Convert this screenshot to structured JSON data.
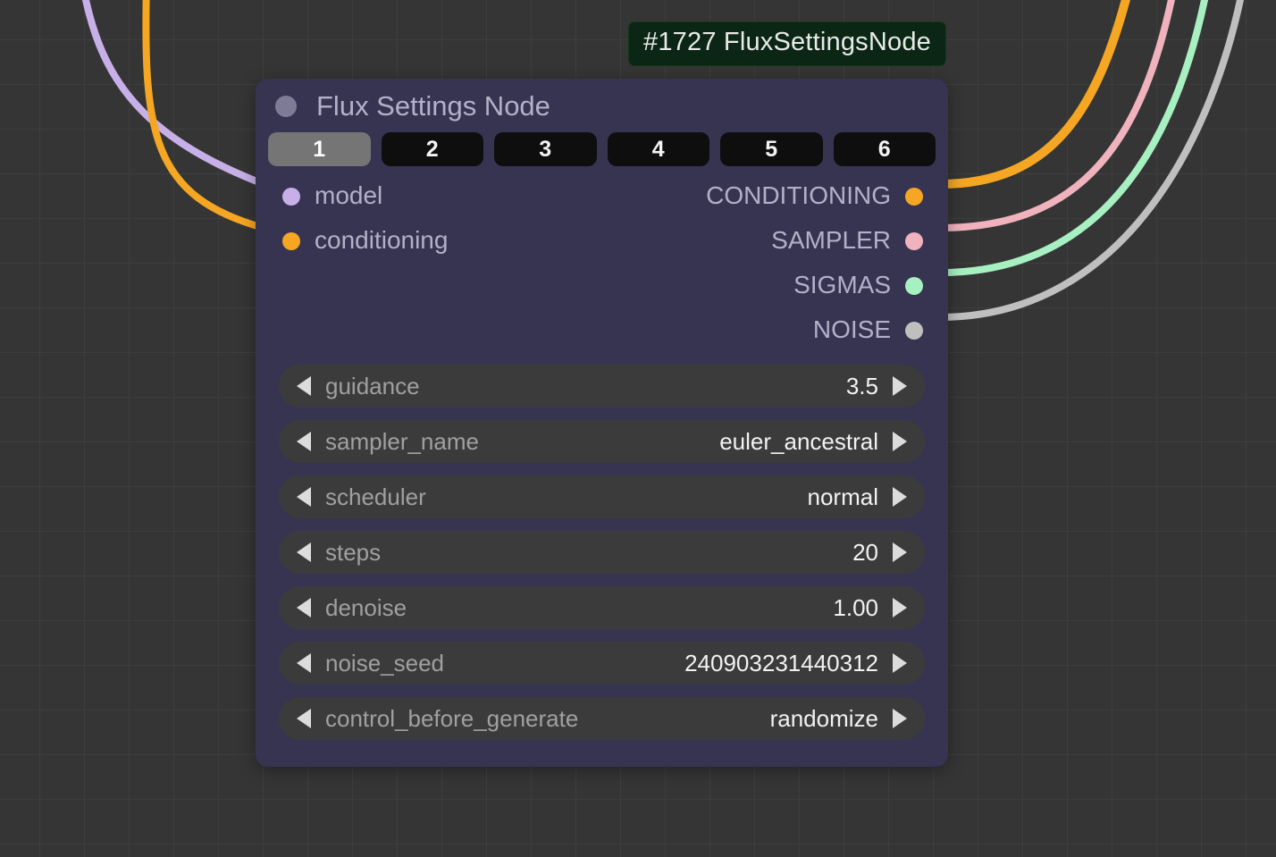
{
  "badge": "#1727 FluxSettingsNode",
  "node": {
    "title": "Flux Settings Node",
    "tabs": [
      "1",
      "2",
      "3",
      "4",
      "5",
      "6"
    ],
    "active_tab": 0,
    "inputs": [
      {
        "name": "model",
        "color": "#c7b0e8"
      },
      {
        "name": "conditioning",
        "color": "#f5a623"
      }
    ],
    "outputs": [
      {
        "name": "CONDITIONING",
        "color": "#f5a623"
      },
      {
        "name": "SAMPLER",
        "color": "#f0b2bc"
      },
      {
        "name": "SIGMAS",
        "color": "#a7f0c1"
      },
      {
        "name": "NOISE",
        "color": "#bfbfbf"
      }
    ],
    "widgets": [
      {
        "label": "guidance",
        "value": "3.5"
      },
      {
        "label": "sampler_name",
        "value": "euler_ancestral"
      },
      {
        "label": "scheduler",
        "value": "normal"
      },
      {
        "label": "steps",
        "value": "20"
      },
      {
        "label": "denoise",
        "value": "1.00"
      },
      {
        "label": "noise_seed",
        "value": "240903231440312"
      },
      {
        "label": "control_before_generate",
        "value": "randomize"
      }
    ]
  },
  "wire_colors": {
    "model": "#c7b0e8",
    "conditioning": "#f5a623",
    "sampler": "#f0b2bc",
    "sigmas": "#a7f0c1",
    "noise": "#bfbfbf"
  }
}
